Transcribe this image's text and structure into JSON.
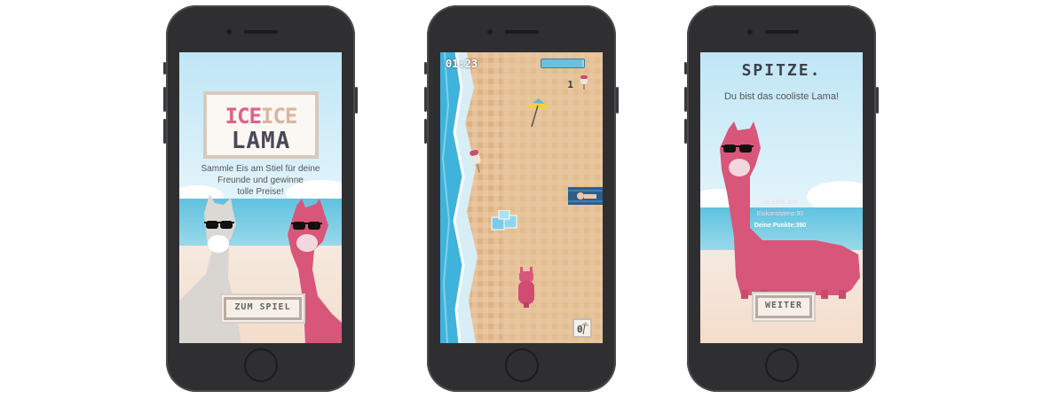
{
  "screens": {
    "start": {
      "logo_word1": "ICE",
      "logo_word2": "ICE",
      "logo_word3": "LAMA",
      "tagline_lines": [
        "Sammle Eis am Stiel für deine",
        "Freunde und gewinne",
        "tolle Preise!"
      ],
      "button_label": "ZUM SPIEL"
    },
    "game": {
      "timer": "01:23",
      "progress": 0.95,
      "score_count": "1",
      "umbrella_count": "0"
    },
    "result": {
      "title": "SPITZE.",
      "subtitle": "Du bist das cooliste Lama!",
      "stat_ice": "15 x Eis:300",
      "stat_consistency": "Eiskonsistenz:90",
      "stat_points": "Deine Punkte:390",
      "button_label": "WEITER"
    }
  },
  "colors": {
    "phone": "#2f2f31",
    "llama_pink": "#d8567a",
    "llama_grey": "#d8d6d2",
    "sky": "#c9eaf6",
    "sea": "#5fc2df",
    "sand": "#f3ddcc",
    "logo_pink": "#e0608a",
    "logo_beige": "#d6b6a3",
    "logo_dark": "#4a4a57"
  },
  "icons": [
    "sunglasses-icon",
    "popsicle-icon",
    "umbrella-icon",
    "ice-cube-icon",
    "beach-towel-icon"
  ]
}
